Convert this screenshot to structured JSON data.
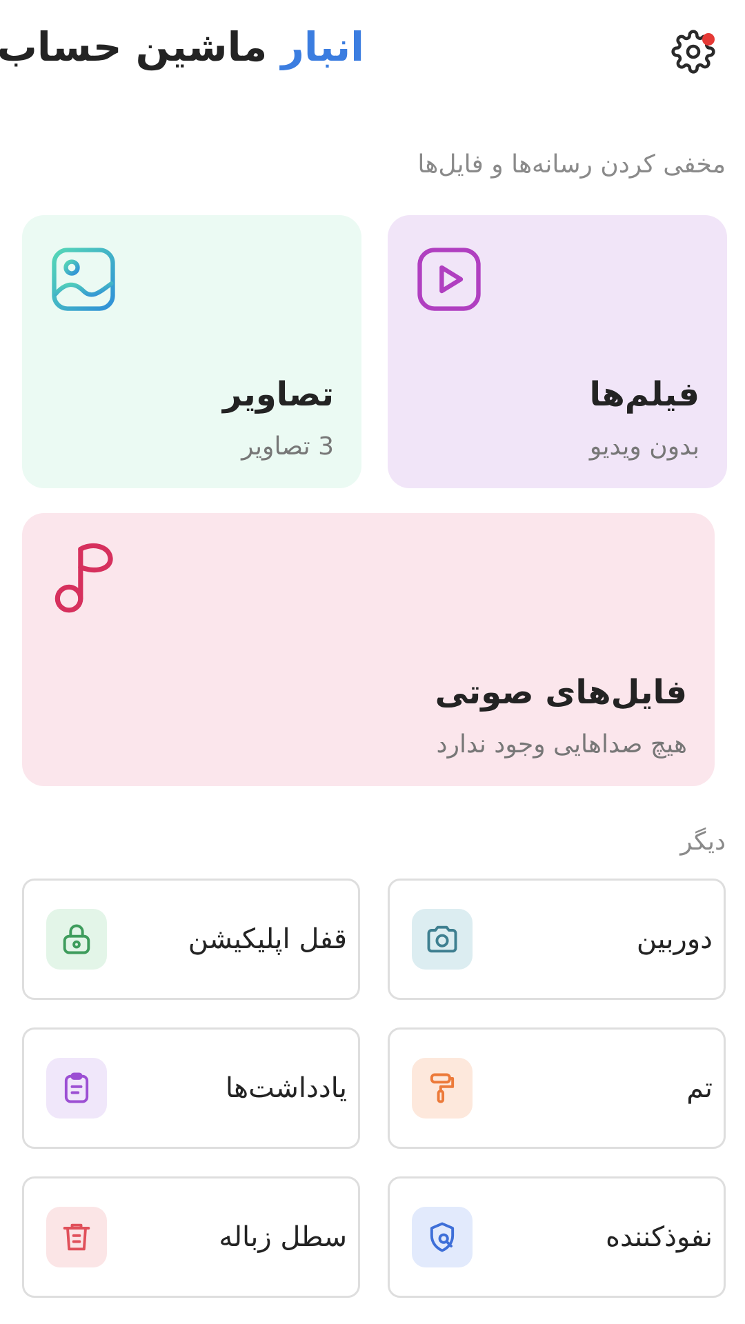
{
  "header": {
    "title_accent": "انبار",
    "title_rest": "ماشین حساب",
    "settings_icon": "gear-icon",
    "notification_dot_color": "#e53935"
  },
  "sections": {
    "hide_media": "مخفی کردن رسانه‌ها و فایل‌ها",
    "other": "دیگر"
  },
  "media_cards": {
    "videos": {
      "title": "فیلم‌ها",
      "subtitle": "بدون ویدیو",
      "icon": "video-play-icon",
      "bg": "#f1e5f8",
      "accent": "#b03fc0"
    },
    "images": {
      "title": "تصاویر",
      "subtitle": "3 تصاویر",
      "icon": "image-icon",
      "bg": "#ebfaf3",
      "accent": "#3cb8b8"
    },
    "audio": {
      "title": "فایل‌های صوتی",
      "subtitle": "هیچ صداهایی وجود ندارد",
      "icon": "music-note-icon",
      "bg": "#fbe6ec",
      "accent": "#d6305d"
    }
  },
  "tiles": [
    {
      "label": "دوربین",
      "icon": "camera-icon",
      "bg": "#dcedf1",
      "color": "#3e7f90"
    },
    {
      "label": "قفل اپلیکیشن",
      "icon": "lock-icon",
      "bg": "#e3f5e8",
      "color": "#3e9c5c"
    },
    {
      "label": "تم",
      "icon": "paint-roller-icon",
      "bg": "#fde8dc",
      "color": "#ec7a3a"
    },
    {
      "label": "یادداشت‌ها",
      "icon": "notes-icon",
      "bg": "#f0e7fa",
      "color": "#9c4fd3"
    },
    {
      "label": "نفوذکننده",
      "icon": "intruder-shield-icon",
      "bg": "#e2eafc",
      "color": "#3e6fd8"
    },
    {
      "label": "سطل زباله",
      "icon": "trash-icon",
      "bg": "#fbe5e6",
      "color": "#e0505a"
    }
  ]
}
